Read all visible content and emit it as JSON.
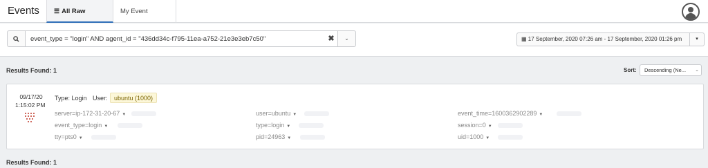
{
  "app": {
    "title": "Events"
  },
  "tabs": [
    {
      "label": "All Raw Events",
      "active": true,
      "icon": "list-icon"
    },
    {
      "label": "My Event Queue",
      "active": false
    }
  ],
  "search": {
    "query": "event_type = \"login\" AND agent_id = \"436dd34c-f795-11ea-a752-21e3e3eb7c50\"",
    "clear_glyph": "✖",
    "dropdown_glyph": "⌄"
  },
  "date_range": {
    "label": "17 September, 2020 07:26 am - 17 September, 2020 01:26 pm",
    "caret": "▾"
  },
  "results": {
    "label_top": "Results Found: 1",
    "label_bottom": "Results Found: 1",
    "sort_label": "Sort:",
    "sort_value": "Descending (Ne...",
    "sort_caret": "⌄"
  },
  "event": {
    "date": "09/17/20",
    "time": "1:15:02 PM",
    "type_label": "Type:",
    "type_value": "Login",
    "user_label": "User:",
    "user_value": "ubuntu (1000)",
    "fields": [
      {
        "text": "server=ip-172-31-20-67"
      },
      {
        "text": "user=ubuntu"
      },
      {
        "text": "event_time=1600362902289"
      },
      {
        "text": "event_type=login"
      },
      {
        "text": "type=login"
      },
      {
        "text": "session=0"
      },
      {
        "text": "tty=pts0"
      },
      {
        "text": "pid=24963"
      },
      {
        "text": "uid=1000"
      }
    ],
    "field_caret": "▼"
  },
  "colors": {
    "accent": "#2f6fb8",
    "badge_bg": "#fcf7d9",
    "dots": "#c0392b"
  }
}
